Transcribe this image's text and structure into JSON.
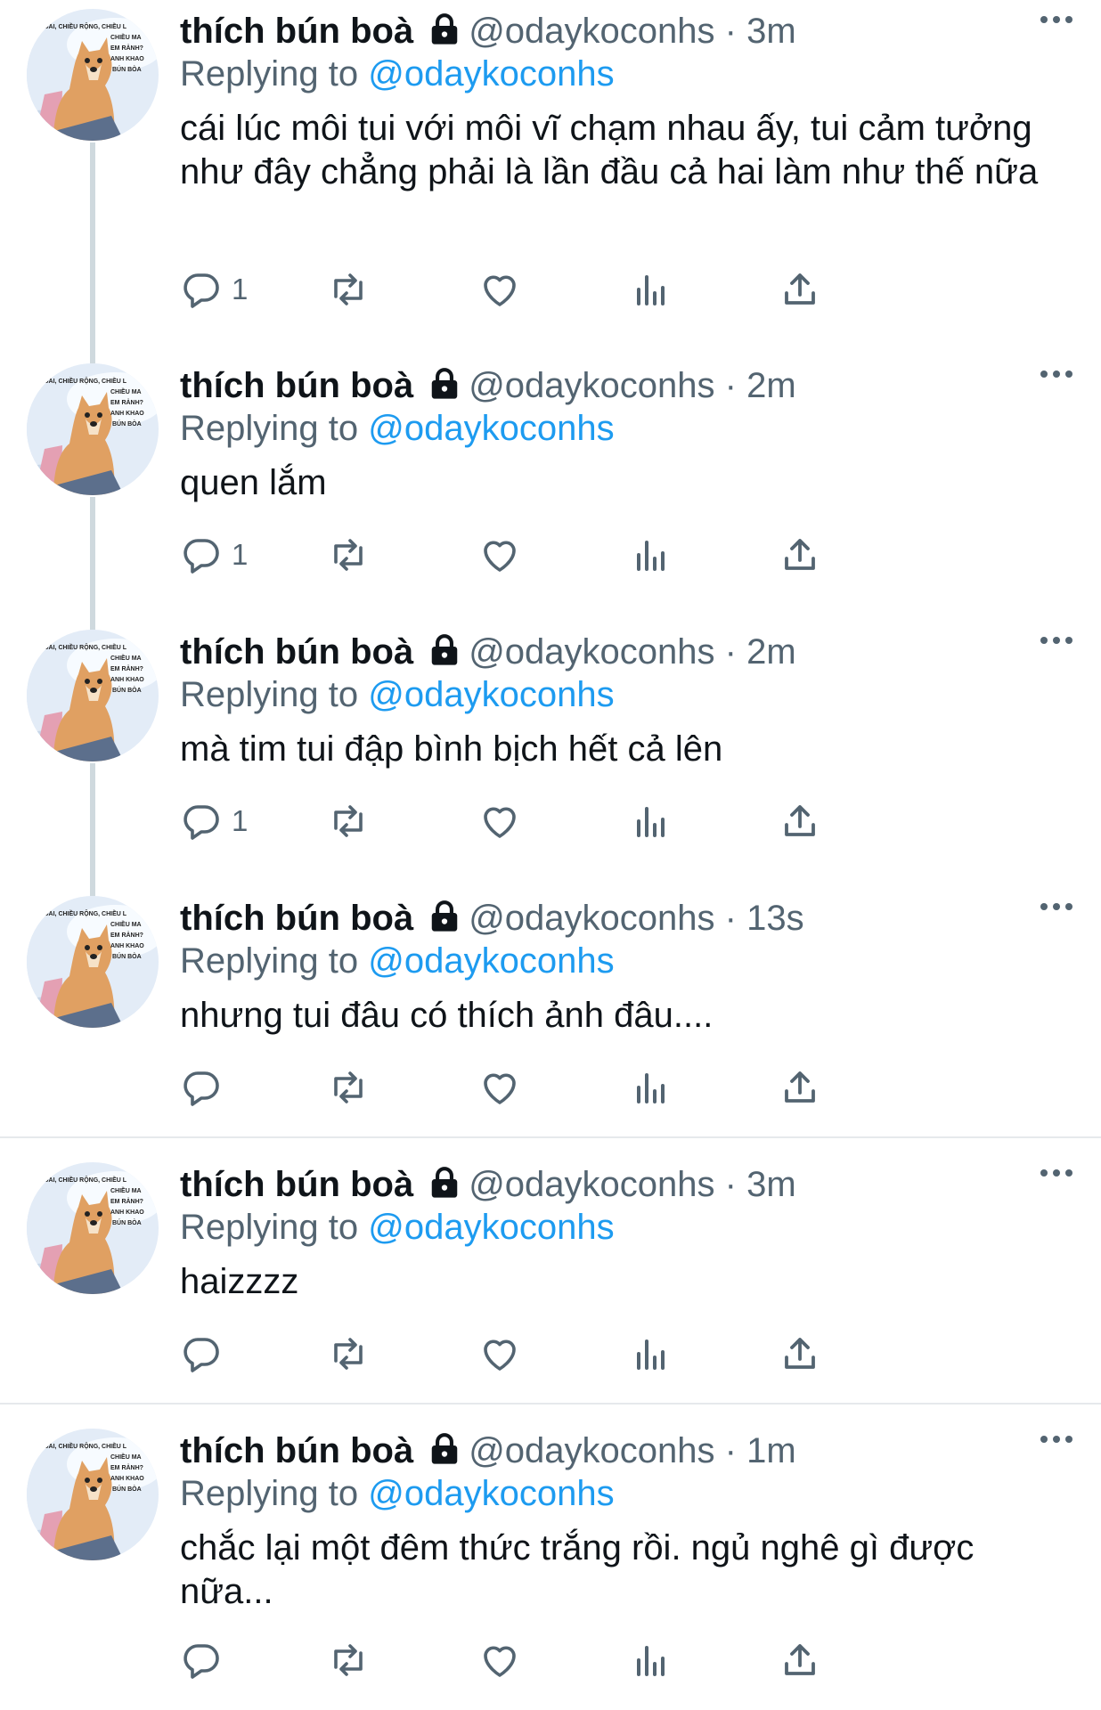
{
  "tweets": [
    {
      "name": "thích bún boà",
      "handle": "@odaykoconhs",
      "dot": "·",
      "time": "3m",
      "replying_prefix": "Replying to",
      "replying_to": "@odaykoconhs",
      "text": "cái lúc môi tui với môi vĩ chạm nhau ấy, tui cảm tưởng như đây chẳng phải là lần đầu cả hai làm như thế nữa",
      "reply_count": "1"
    },
    {
      "name": "thích bún boà",
      "handle": "@odaykoconhs",
      "dot": "·",
      "time": "2m",
      "replying_prefix": "Replying to",
      "replying_to": "@odaykoconhs",
      "text": "quen lắm",
      "reply_count": "1"
    },
    {
      "name": "thích bún boà",
      "handle": "@odaykoconhs",
      "dot": "·",
      "time": "2m",
      "replying_prefix": "Replying to",
      "replying_to": "@odaykoconhs",
      "text": "mà tim tui đập bình bịch hết cả lên",
      "reply_count": "1"
    },
    {
      "name": "thích bún boà",
      "handle": "@odaykoconhs",
      "dot": "·",
      "time": "13s",
      "replying_prefix": "Replying to",
      "replying_to": "@odaykoconhs",
      "text": "nhưng tui đâu có thích ảnh đâu....",
      "reply_count": ""
    },
    {
      "name": "thích bún boà",
      "handle": "@odaykoconhs",
      "dot": "·",
      "time": "3m",
      "replying_prefix": "Replying to",
      "replying_to": "@odaykoconhs",
      "text": "haizzzz",
      "reply_count": ""
    },
    {
      "name": "thích bún boà",
      "handle": "@odaykoconhs",
      "dot": "·",
      "time": "1m",
      "replying_prefix": "Replying to",
      "replying_to": "@odaykoconhs",
      "text": "chắc lại một đêm thức trắng rồi. ngủ nghê gì được nữa...",
      "reply_count": ""
    }
  ],
  "avatar_caption": [
    "..IÊU DÀI, CHIỀU RỘNG, CHIỀU L",
    "CHIỀU MA",
    "EM RẢNH?",
    "ANH KHAO",
    "BÚN BÒA"
  ],
  "icons": [
    "lock-icon",
    "more-icon",
    "reply-icon",
    "retweet-icon",
    "like-icon",
    "views-icon",
    "share-icon"
  ],
  "colors": {
    "text": "#0f1419",
    "secondary": "#536471",
    "accent": "#1d9bf0",
    "divider": "#e6e9ec",
    "thread_line": "#cfd9de"
  }
}
